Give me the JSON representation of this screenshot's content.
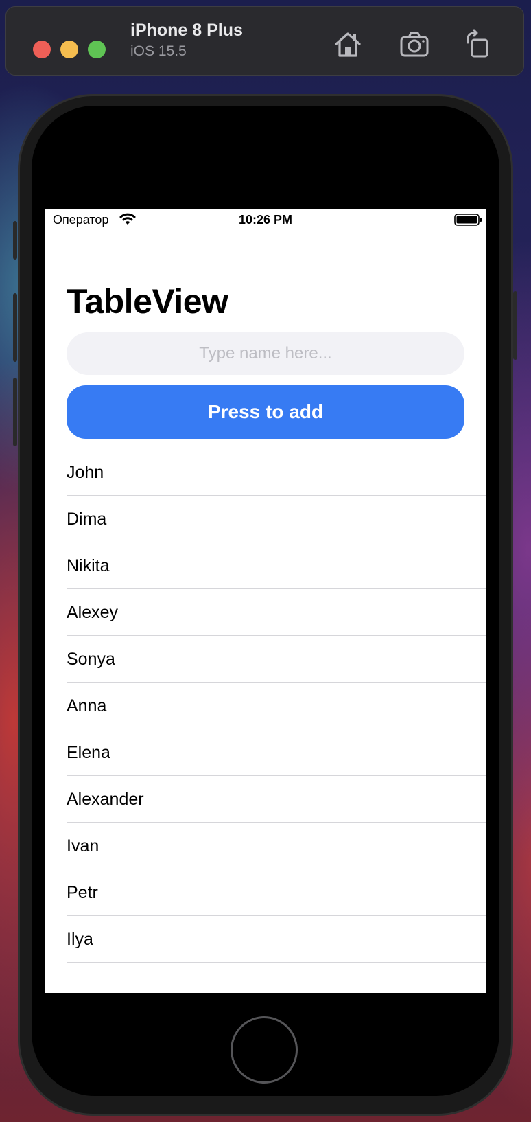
{
  "simulator": {
    "device_name": "iPhone 8 Plus",
    "os_version": "iOS 15.5",
    "toolbar_icons": [
      "home-icon",
      "camera-icon",
      "rotate-icon"
    ]
  },
  "status_bar": {
    "carrier": "Оператор",
    "time": "10:26 PM",
    "icons": [
      "wifi-icon",
      "battery-icon"
    ]
  },
  "screen": {
    "title": "TableView",
    "input": {
      "placeholder": "Type name here...",
      "value": ""
    },
    "add_button_label": "Press to add",
    "names": [
      "John",
      "Dima",
      "Nikita",
      "Alexey",
      "Sonya",
      "Anna",
      "Elena",
      "Alexander",
      "Ivan",
      "Petr",
      "Ilya"
    ]
  },
  "colors": {
    "accent_button": "#377bf3",
    "input_background": "#f2f2f6",
    "separator": "#d6d6da"
  }
}
